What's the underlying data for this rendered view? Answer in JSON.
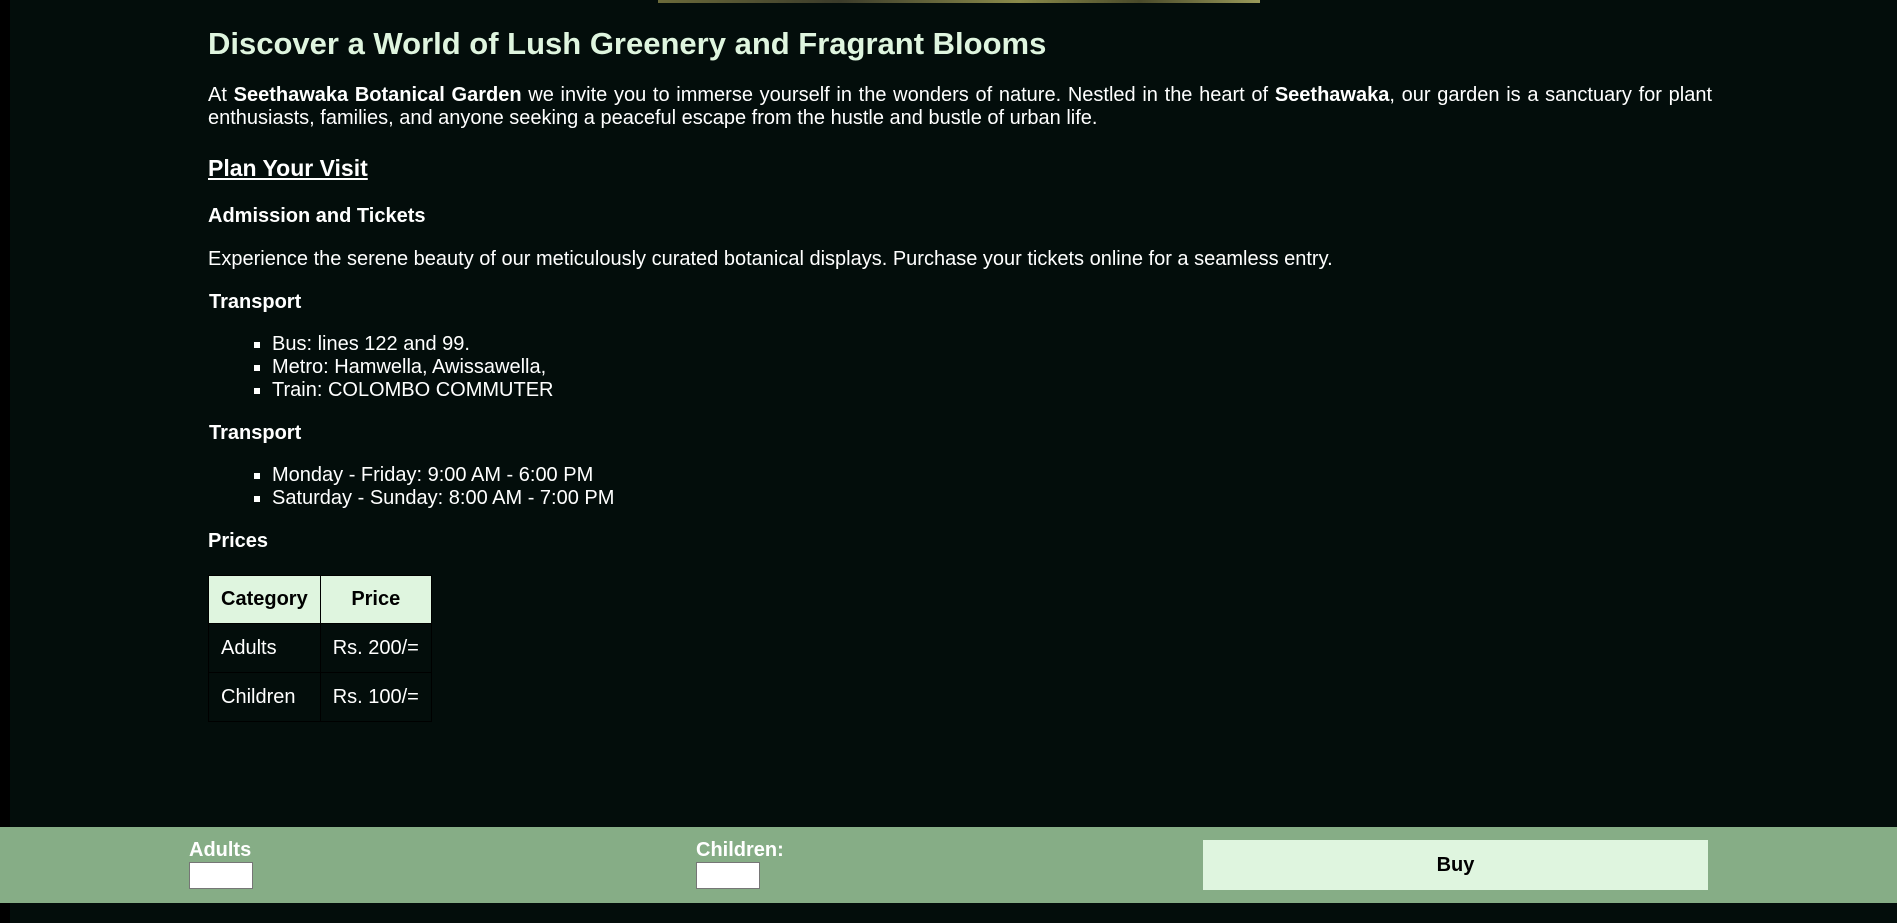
{
  "hero": {
    "heading": "Discover a World of Lush Greenery and Fragrant Blooms"
  },
  "intro": {
    "part1": "At ",
    "garden_name": "Seethawaka Botanical Garden",
    "part2": " we invite you to immerse yourself in the wonders of nature. Nestled in the heart of ",
    "place_name": "Seethawaka",
    "part3": ", our garden is a sanctuary for plant enthusiasts, families, and anyone seeking a peaceful escape from the hustle and bustle of urban life."
  },
  "plan_visit": {
    "title": "Plan Your Visit",
    "admission_heading": "Admission and Tickets",
    "admission_text": "Experience the serene beauty of our meticulously curated botanical displays. Purchase your tickets online for a seamless entry.",
    "transport_heading": "Transport",
    "transport_items": [
      "Bus: lines 122 and 99.",
      "Metro: Hamwella, Awissawella,",
      "Train: COLOMBO COMMUTER"
    ],
    "hours_heading": "Transport",
    "hours_items": [
      "Monday - Friday: 9:00 AM - 6:00 PM",
      "Saturday - Sunday: 8:00 AM - 7:00 PM"
    ],
    "prices_heading": "Prices"
  },
  "prices_table": {
    "headers": [
      "Category",
      "Price"
    ],
    "rows": [
      [
        "Adults",
        "Rs. 200/="
      ],
      [
        "Children",
        "Rs. 100/="
      ]
    ]
  },
  "purchase_bar": {
    "adults_label": "Adults",
    "adults_value": "",
    "children_label": "Children:",
    "children_value": "",
    "buy_label": "Buy"
  },
  "colors": {
    "page_background": "#030d0b",
    "heading_accent": "#dff5df",
    "footer_bar": "#86ad86",
    "button_background": "#dff5df"
  }
}
